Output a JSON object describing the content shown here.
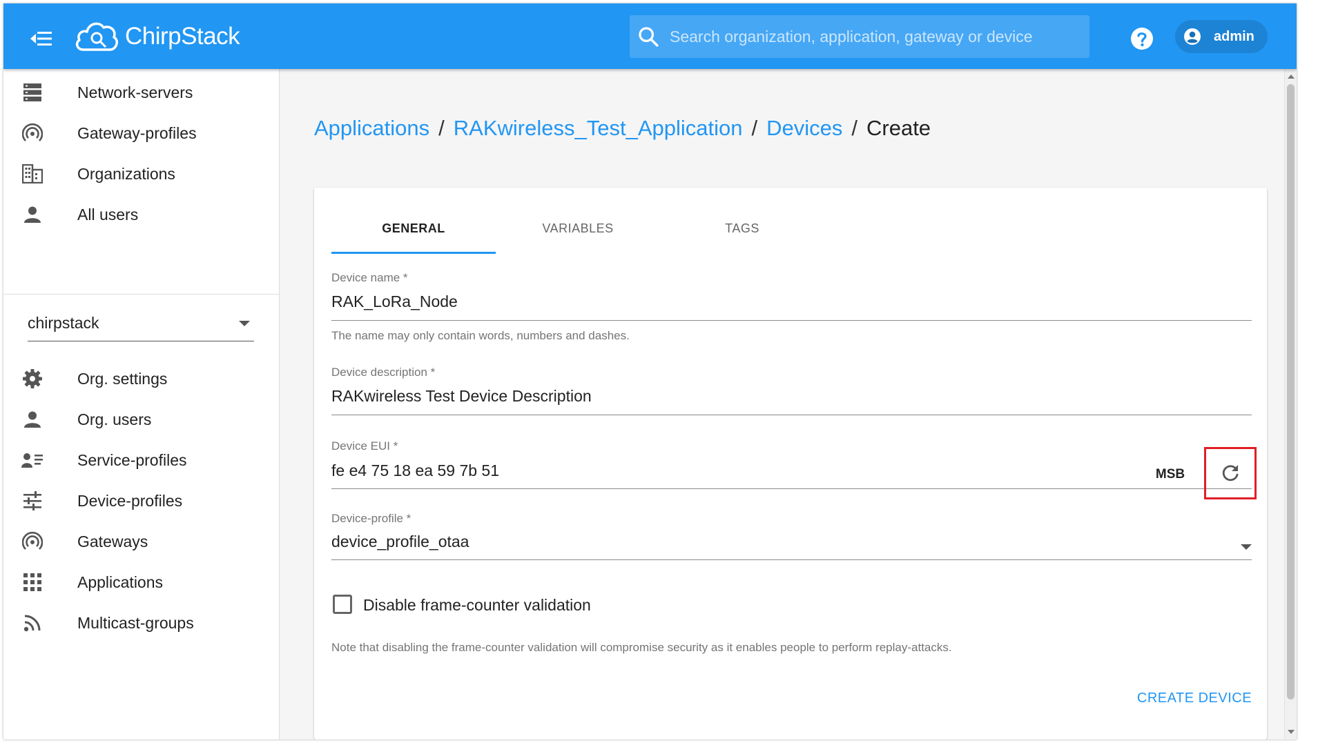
{
  "header": {
    "brand": "ChirpStack",
    "search_placeholder": "Search organization, application, gateway or device",
    "user_label": "admin"
  },
  "sidebar": {
    "admin_items": [
      {
        "label": "Network-servers",
        "icon": "server-icon"
      },
      {
        "label": "Gateway-profiles",
        "icon": "wifi-tethering-icon"
      },
      {
        "label": "Organizations",
        "icon": "domain-icon"
      },
      {
        "label": "All users",
        "icon": "person-icon"
      }
    ],
    "org_select_value": "chirpstack",
    "org_items": [
      {
        "label": "Org. settings",
        "icon": "gear-icon"
      },
      {
        "label": "Org. users",
        "icon": "person-icon"
      },
      {
        "label": "Service-profiles",
        "icon": "account-details-icon"
      },
      {
        "label": "Device-profiles",
        "icon": "tune-icon"
      },
      {
        "label": "Gateways",
        "icon": "wifi-tethering-icon"
      },
      {
        "label": "Applications",
        "icon": "apps-grid-icon"
      },
      {
        "label": "Multicast-groups",
        "icon": "rss-icon"
      }
    ]
  },
  "breadcrumb": {
    "items": [
      "Applications",
      "RAKwireless_Test_Application",
      "Devices"
    ],
    "separator": "/",
    "current": "Create"
  },
  "tabs": [
    "GENERAL",
    "VARIABLES",
    "TAGS"
  ],
  "form": {
    "device_name_label": "Device name *",
    "device_name_value": "RAK_LoRa_Node",
    "device_name_help": "The name may only contain words, numbers and dashes.",
    "description_label": "Device description *",
    "description_value": "RAKwireless Test Device Description",
    "eui_label": "Device EUI *",
    "eui_value": "fe e4 75 18 ea 59 7b 51",
    "eui_byte_order": "MSB",
    "profile_label": "Device-profile *",
    "profile_value": "device_profile_otaa",
    "disable_fcnt_label": "Disable frame-counter validation",
    "disable_fcnt_checked": false,
    "disable_fcnt_help": "Note that disabling the frame-counter validation will compromise security as it enables people to perform replay-attacks.",
    "submit_label": "CREATE DEVICE"
  },
  "colors": {
    "primary": "#2196f3",
    "highlight": "#e01d27"
  }
}
